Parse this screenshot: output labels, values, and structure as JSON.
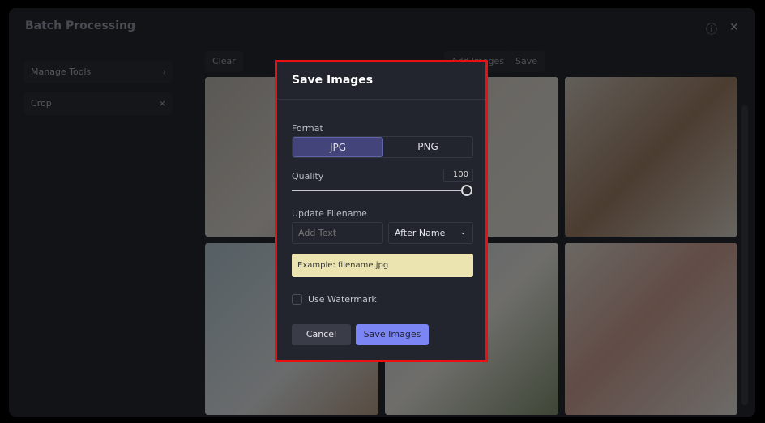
{
  "window": {
    "title": "Batch Processing",
    "info_icon": "info-icon",
    "close_icon": "close-icon"
  },
  "sidebar": {
    "items": [
      {
        "label": "Manage Tools",
        "icon": "chevron-right-icon",
        "glyph": "›"
      },
      {
        "label": "Crop",
        "icon": "close-icon",
        "glyph": "×"
      }
    ]
  },
  "toolbar": {
    "clear": "Clear",
    "add_images": "Add Images",
    "save": "Save"
  },
  "modal": {
    "title": "Save Images",
    "format_label": "Format",
    "formats": [
      "JPG",
      "PNG"
    ],
    "selected_format": "JPG",
    "quality_label": "Quality",
    "quality_value": "100",
    "quality_percent": 100,
    "filename_label": "Update Filename",
    "filename_placeholder": "Add Text",
    "position_option": "After Name",
    "example": "Example: filename.jpg",
    "watermark_label": "Use Watermark",
    "watermark_checked": false,
    "cancel": "Cancel",
    "save": "Save Images"
  },
  "colors": {
    "accent": "#7b86f4",
    "highlight": "#e81010",
    "example_bg": "#ebe4b1"
  }
}
